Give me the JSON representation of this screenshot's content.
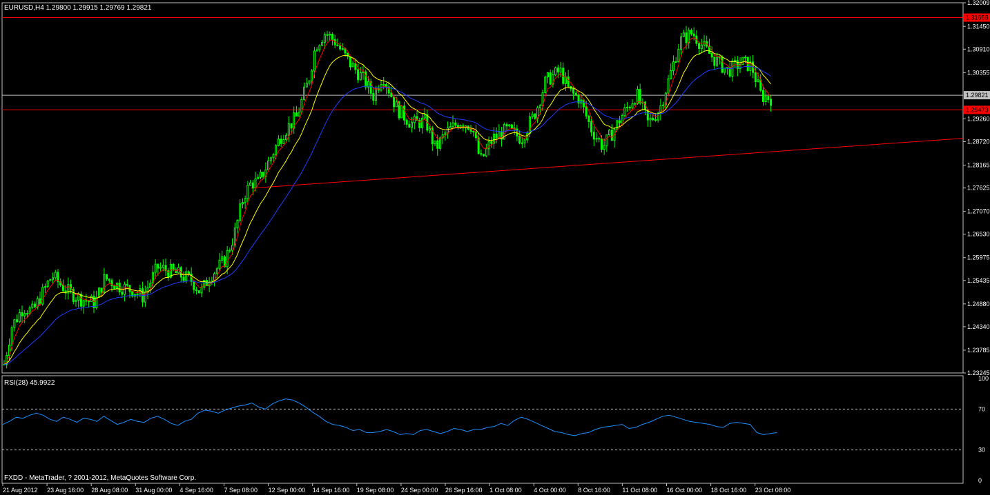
{
  "chart_data": [
    {
      "type": "candlestick",
      "symbol_header": "EURUSD,H4  1.29800 1.29915 1.29769 1.29821",
      "ylim": [
        1.23245,
        1.32009
      ],
      "y_ticks": [
        "1.32009",
        "1.31450",
        "1.30910",
        "1.30355",
        "1.29260",
        "1.28720",
        "1.28165",
        "1.27625",
        "1.27070",
        "1.26530",
        "1.25975",
        "1.25435",
        "1.24880",
        "1.24340",
        "1.23785",
        "1.23245"
      ],
      "price_labels": [
        {
          "text": "1.31658",
          "value": 1.31658,
          "bg": "#ff0000"
        },
        {
          "text": "1.29821",
          "value": 1.29821,
          "bg": "#c0c0c0"
        },
        {
          "text": "1.29473",
          "value": 1.29473,
          "bg": "#ff0000"
        }
      ],
      "horizontal_lines": [
        {
          "value": 1.31658,
          "color": "#ff0000"
        },
        {
          "value": 1.29473,
          "color": "#ff0000"
        },
        {
          "value": 1.29821,
          "color": "#c0c0c0"
        }
      ],
      "trendline": {
        "from": [
          1.2762,
          0.2594
        ],
        "to": [
          1.288,
          1.0
        ],
        "color": "#ff0000"
      },
      "series": [
        {
          "role": "ma-fast",
          "color": "#ff0000"
        },
        {
          "role": "ma-mid",
          "color": "#ffff00"
        },
        {
          "role": "ma-slow",
          "color": "#1e3cff"
        }
      ],
      "close_anchors": [
        [
          0,
          1.2345
        ],
        [
          0.008,
          1.2435
        ],
        [
          0.02,
          1.248
        ],
        [
          0.03,
          1.247
        ],
        [
          0.045,
          1.2535
        ],
        [
          0.05,
          1.2555
        ],
        [
          0.065,
          1.252
        ],
        [
          0.08,
          1.25
        ],
        [
          0.095,
          1.249
        ],
        [
          0.105,
          1.255
        ],
        [
          0.12,
          1.253
        ],
        [
          0.135,
          1.252
        ],
        [
          0.145,
          1.2505
        ],
        [
          0.16,
          1.2575
        ],
        [
          0.18,
          1.256
        ],
        [
          0.195,
          1.2545
        ],
        [
          0.205,
          1.2515
        ],
        [
          0.215,
          1.2555
        ],
        [
          0.23,
          1.259
        ],
        [
          0.24,
          1.265
        ],
        [
          0.25,
          1.2745
        ],
        [
          0.258,
          1.2775
        ],
        [
          0.265,
          1.2775
        ],
        [
          0.275,
          1.282
        ],
        [
          0.29,
          1.289
        ],
        [
          0.305,
          1.293
        ],
        [
          0.318,
          1.302
        ],
        [
          0.325,
          1.31
        ],
        [
          0.335,
          1.313
        ],
        [
          0.345,
          1.311
        ],
        [
          0.36,
          1.306
        ],
        [
          0.375,
          1.302
        ],
        [
          0.385,
          1.298
        ],
        [
          0.395,
          1.303
        ],
        [
          0.41,
          1.295
        ],
        [
          0.425,
          1.2915
        ],
        [
          0.44,
          1.292
        ],
        [
          0.45,
          1.2855
        ],
        [
          0.46,
          1.289
        ],
        [
          0.475,
          1.292
        ],
        [
          0.488,
          1.291
        ],
        [
          0.497,
          1.2825
        ],
        [
          0.51,
          1.288
        ],
        [
          0.525,
          1.29
        ],
        [
          0.54,
          1.288
        ],
        [
          0.555,
          1.2945
        ],
        [
          0.565,
          1.3015
        ],
        [
          0.58,
          1.304
        ],
        [
          0.59,
          1.299
        ],
        [
          0.6,
          1.2975
        ],
        [
          0.613,
          1.29
        ],
        [
          0.625,
          1.286
        ],
        [
          0.635,
          1.2895
        ],
        [
          0.645,
          1.2935
        ],
        [
          0.66,
          1.2985
        ],
        [
          0.672,
          1.2915
        ],
        [
          0.684,
          1.295
        ],
        [
          0.695,
          1.303
        ],
        [
          0.705,
          1.311
        ],
        [
          0.718,
          1.313
        ],
        [
          0.73,
          1.3095
        ],
        [
          0.742,
          1.3065
        ],
        [
          0.755,
          1.304
        ],
        [
          0.77,
          1.306
        ],
        [
          0.78,
          1.305
        ],
        [
          0.79,
          1.298
        ],
        [
          0.8,
          1.2975
        ]
      ],
      "x_extent_fraction": 0.8,
      "x_tick_labels": [
        "21 Aug 2012",
        "23 Aug 16:00",
        "28 Aug 08:00",
        "31 Aug 00:00",
        "4 Sep 16:00",
        "7 Sep 08:00",
        "12 Sep 00:00",
        "14 Sep 16:00",
        "19 Sep 08:00",
        "24 Sep 00:00",
        "26 Sep 16:00",
        "1 Oct 08:00",
        "4 Oct 00:00",
        "8 Oct 16:00",
        "11 Oct 08:00",
        "16 Oct 00:00",
        "18 Oct 16:00",
        "23 Oct 08:00"
      ],
      "candle_colors": {
        "bull": "#00ff00",
        "bear": "#00ff00",
        "bull_body": "#000000",
        "bear_body": "#00ff00"
      },
      "grid": false
    },
    {
      "type": "line",
      "title": "RSI(28) 45.9922",
      "ylim": [
        0,
        100
      ],
      "y_ticks": [
        "100",
        "70",
        "30",
        "0"
      ],
      "levels": [
        70,
        30
      ],
      "series": [
        {
          "color": "#1e90ff",
          "values": [
            55,
            58,
            62,
            61,
            64,
            66,
            64,
            60,
            58,
            62,
            60,
            57,
            61,
            60,
            58,
            63,
            59,
            55,
            57,
            60,
            58,
            57,
            61,
            63,
            60,
            56,
            54,
            58,
            60,
            66,
            69,
            68,
            66,
            69,
            71,
            73,
            74,
            76,
            72,
            70,
            75,
            78,
            80,
            79,
            76,
            72,
            67,
            63,
            58,
            55,
            54,
            52,
            49,
            50,
            47,
            47,
            48,
            50,
            48,
            45,
            46,
            45,
            49,
            50,
            48,
            46,
            48,
            51,
            50,
            48,
            50,
            50,
            52,
            53,
            56,
            54,
            59,
            62,
            60,
            57,
            54,
            51,
            48,
            47,
            45,
            44,
            46,
            47,
            50,
            52,
            53,
            54,
            55,
            51,
            52,
            55,
            57,
            60,
            63,
            64,
            62,
            60,
            58,
            57,
            56,
            55,
            53,
            52,
            56,
            57,
            56,
            55,
            47,
            45,
            46,
            47
          ]
        }
      ],
      "grid": false
    }
  ],
  "footer": {
    "copyright": "FXDD - MetaTrader, ? 2001-2012, MetaQuotes Software Corp."
  }
}
